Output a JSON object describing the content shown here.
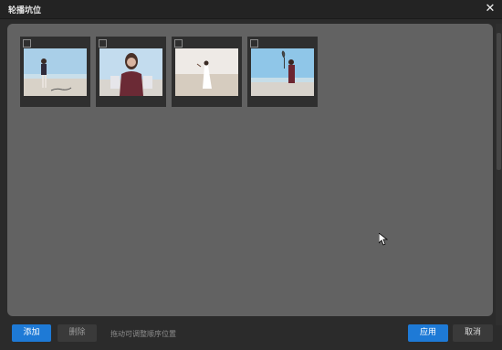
{
  "window": {
    "title": "轮播坑位",
    "close_glyph": "✕"
  },
  "gallery": {
    "items": [
      {
        "checked": false
      },
      {
        "checked": false
      },
      {
        "checked": false
      },
      {
        "checked": false
      }
    ]
  },
  "footer": {
    "add_label": "添加",
    "delete_label": "删除",
    "hint": "拖动可调整顺序位置",
    "apply_label": "应用",
    "cancel_label": "取消"
  },
  "colors": {
    "accent": "#1e7ad6",
    "panel": "#626262",
    "background": "#2b2b2b"
  }
}
